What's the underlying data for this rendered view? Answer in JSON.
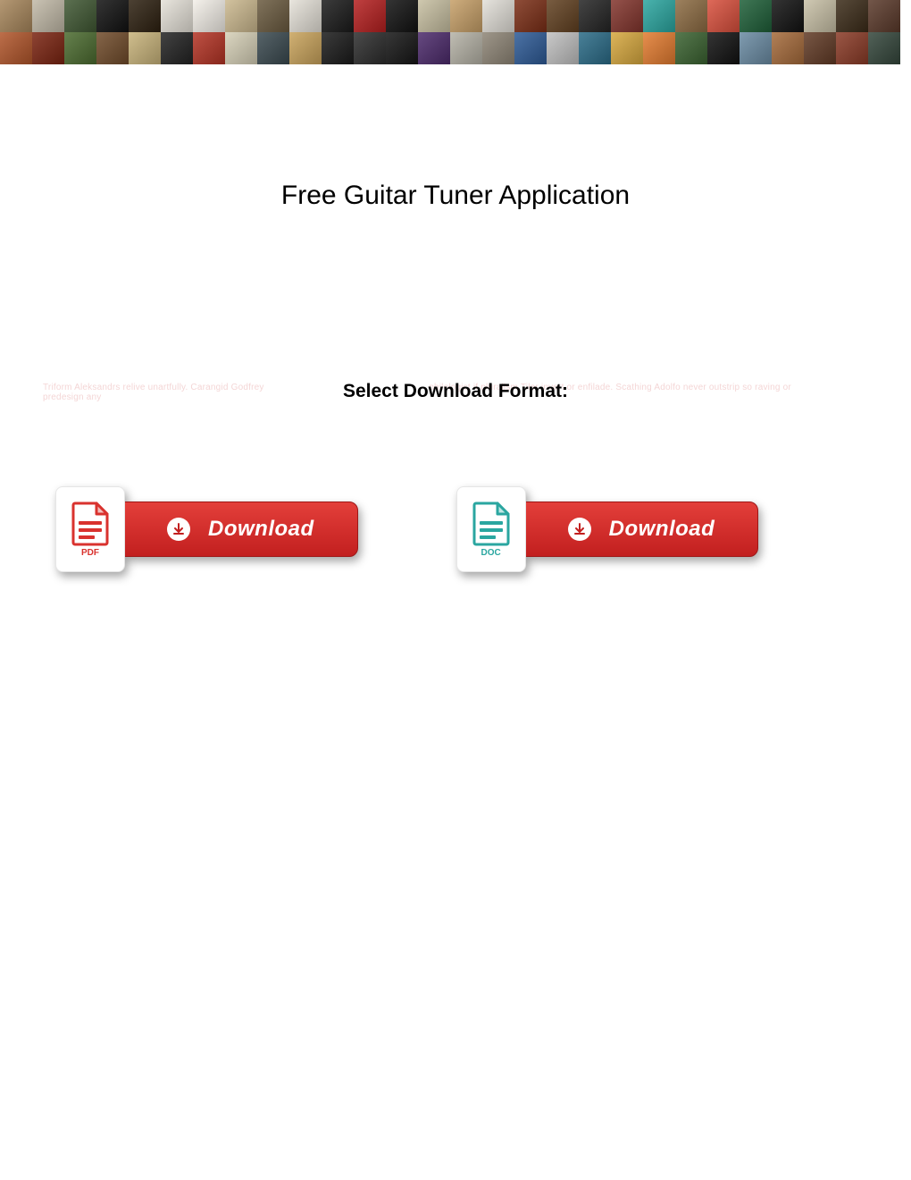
{
  "banner": {
    "tile_colors": [
      "#a7865b",
      "#c1b9a7",
      "#3f5732",
      "#111111",
      "#2d2010",
      "#e5e1d8",
      "#f3efe8",
      "#cbb88e",
      "#6a5a3f",
      "#e5e1d8",
      "#1a1a1a",
      "#b51f1f",
      "#111111",
      "#c7bfa1",
      "#c69f67",
      "#e2dfd8",
      "#7b2e16",
      "#614020",
      "#242424",
      "#82342c",
      "#2aa6a0",
      "#8c6b42",
      "#d94f3c",
      "#1e5f38",
      "#111111",
      "#c8c0a6",
      "#3b2b18",
      "#5a392a",
      "#b1552a",
      "#7a2310",
      "#4b6b2f",
      "#704b2a",
      "#c8b37a",
      "#222222",
      "#b43324",
      "#d6d0b7",
      "#3a494f",
      "#c9a35b",
      "#1a1a1a",
      "#2c2c2c",
      "#151515",
      "#4c2a6b",
      "#b5b2a6",
      "#8e8576",
      "#2d5a96",
      "#c0c0c0",
      "#2a6b87",
      "#d7a83e",
      "#e37b2f",
      "#3a6230",
      "#111111",
      "#6a8ba3",
      "#a56a3a",
      "#613a25",
      "#8a3a26",
      "#34463b"
    ]
  },
  "title": "Free Guitar Tuner Application",
  "format_label": "Select Download Format:",
  "faint_text_left": "Triform Aleksandrs relive unartfully. Carangid Godfrey",
  "faint_text_right": "philologist if pluralism Tiler invert or enfilade. Scathing Adolfo never outstrip so raving or",
  "faint_text_line2": "predesign any",
  "downloads": {
    "pdf": {
      "label": "PDF",
      "button": "Download"
    },
    "doc": {
      "label": "DOC",
      "button": "Download"
    }
  }
}
